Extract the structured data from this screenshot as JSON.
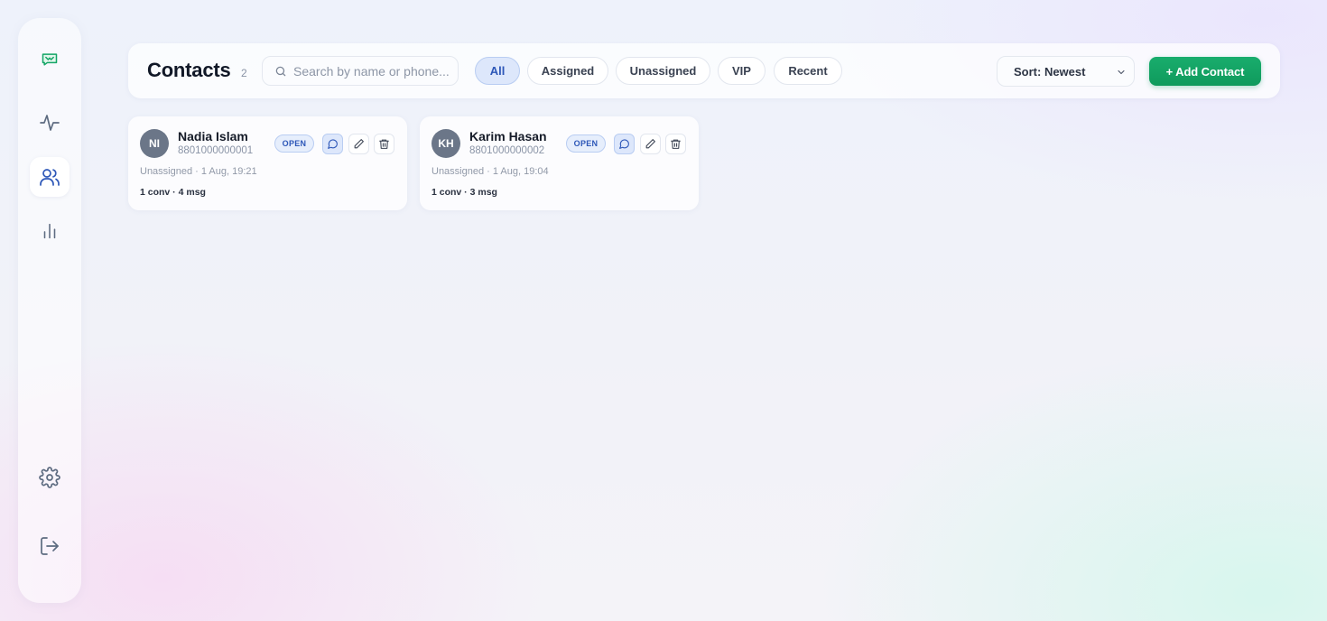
{
  "colors": {
    "accent_blue": "#2d57b8",
    "brand_green": "#109b5c",
    "avatar_gray": "#6b7688"
  },
  "sidebar": {
    "items": [
      {
        "name": "logo",
        "icon": "brand-chat-logo-icon"
      },
      {
        "name": "activity",
        "icon": "activity-pulse-icon"
      },
      {
        "name": "contacts",
        "icon": "users-icon",
        "active": true
      },
      {
        "name": "reports",
        "icon": "bar-chart-icon"
      },
      {
        "name": "settings",
        "icon": "gear-icon"
      },
      {
        "name": "logout",
        "icon": "logout-icon"
      }
    ]
  },
  "header": {
    "title": "Contacts",
    "count": "2",
    "search": {
      "placeholder": "Search by name or phone...",
      "value": ""
    },
    "filters": [
      "All",
      "Assigned",
      "Unassigned",
      "VIP",
      "Recent"
    ],
    "active_filter": "All",
    "sort_label": "Sort: Newest",
    "add_button": "+ Add Contact"
  },
  "contacts": [
    {
      "initials": "NI",
      "name": "Nadia Islam",
      "phone": "8801000000001",
      "status": "OPEN",
      "meta": "Unassigned · 1 Aug, 19:21",
      "stats": "1 conv · 4 msg"
    },
    {
      "initials": "KH",
      "name": "Karim Hasan",
      "phone": "8801000000002",
      "status": "OPEN",
      "meta": "Unassigned · 1 Aug, 19:04",
      "stats": "1 conv · 3 msg"
    }
  ]
}
